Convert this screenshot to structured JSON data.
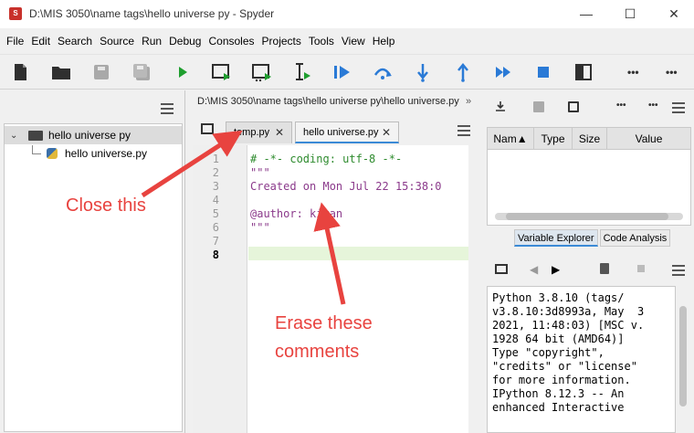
{
  "window": {
    "title": "D:\\MIS 3050\\name tags\\hello universe py - Spyder",
    "app_icon_text": "S",
    "minimize": "—",
    "maximize": "☐",
    "close": "✕"
  },
  "menu": [
    "File",
    "Edit",
    "Search",
    "Source",
    "Run",
    "Debug",
    "Consoles",
    "Projects",
    "Tools",
    "View",
    "Help"
  ],
  "toolbar": {
    "icons": [
      "new-file-icon",
      "open-folder-icon",
      "save-icon",
      "save-all-icon",
      "run-icon",
      "run-cell-icon",
      "run-cell-advance-icon",
      "run-selection-icon",
      "debug-icon",
      "step-over-icon",
      "step-into-icon",
      "step-return-icon",
      "continue-icon",
      "stop-icon",
      "maximize-pane-icon",
      "more-icon",
      "more-icon"
    ],
    "more_label": "•••"
  },
  "file_explorer": {
    "items": [
      {
        "label": "hello universe py",
        "type": "folder",
        "expanded": true
      },
      {
        "label": "hello universe.py",
        "type": "python-file"
      }
    ]
  },
  "editor": {
    "path": "D:\\MIS 3050\\name tags\\hello universe py\\hello universe.py",
    "path_more": "»",
    "tabs": [
      {
        "label": "temp.py",
        "close": "✕",
        "active": false
      },
      {
        "label": "hello universe.py",
        "close": "✕",
        "active": true
      }
    ],
    "lines": [
      {
        "num": "1",
        "text": "# -*- coding: utf-8 -*-"
      },
      {
        "num": "2",
        "text": "\"\"\""
      },
      {
        "num": "3",
        "text": "Created on Mon Jul 22 15:38:0"
      },
      {
        "num": "4",
        "text": ""
      },
      {
        "num": "5",
        "text": "@author: kiran"
      },
      {
        "num": "6",
        "text": "\"\"\""
      },
      {
        "num": "7",
        "text": ""
      },
      {
        "num": "8",
        "text": ""
      }
    ],
    "current_line": "8"
  },
  "variable_explorer": {
    "columns": [
      "Nam▲",
      "Type",
      "Size",
      "Value"
    ],
    "pane_tabs": [
      "Variable Explorer",
      "Code Analysis"
    ]
  },
  "console": {
    "lines": [
      "Python 3.8.10 (tags/",
      "v3.8.10:3d8993a, May  3",
      "2021, 11:48:03) [MSC v.",
      "1928 64 bit (AMD64)]",
      "Type \"copyright\",",
      "\"credits\" or \"license\"",
      "for more information.",
      "",
      "IPython 8.12.3 -- An",
      "enhanced Interactive"
    ]
  },
  "annotations": {
    "close_note": "Close this",
    "erase_note_line1": "Erase these",
    "erase_note_line2": "comments"
  },
  "colors": {
    "annotation": "#e8433f",
    "comment": "#2e8b2e",
    "docstring": "#8b3a8b",
    "accent": "#3b8ad6",
    "run_green": "#1e9e2e",
    "toolbar_blue": "#2a7ad6"
  }
}
